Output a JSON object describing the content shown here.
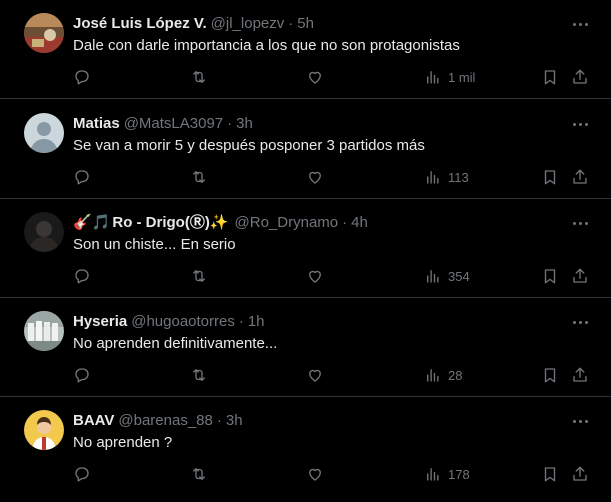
{
  "replies": [
    {
      "name": "José Luis López V.",
      "handle": "@jl_lopezv",
      "time": "5h",
      "text": "Dale con darle importancia a los que no son protagonistas",
      "views": "1 mil",
      "avatar": "landscape-photo-avatar"
    },
    {
      "name": "Matias",
      "handle": "@MatsLA3097",
      "time": "3h",
      "text": "Se van a morir 5 y después posponer 3 partidos más",
      "views": "113",
      "avatar": "default-avatar"
    },
    {
      "name_prefix": "🎸🎵",
      "name": "Ro - Drigo(Ⓡ)",
      "name_suffix": "✨",
      "handle": "@Ro_Drynamo",
      "time": "4h",
      "text": "Son un chiste... En serio",
      "views": "354",
      "avatar": "dark-silhouette-avatar"
    },
    {
      "name": "Hyseria",
      "handle": "@hugoaotorres",
      "time": "1h",
      "text": "No aprenden definitivamente...",
      "views": "28",
      "avatar": "group-photo-avatar"
    },
    {
      "name": "BAAV",
      "handle": "@barenas_88",
      "time": "3h",
      "text": "No aprenden ?",
      "views": "178",
      "avatar": "cartoon-person-avatar"
    }
  ],
  "separator": "·",
  "icons": {
    "reply": "reply-icon",
    "retweet": "retweet-icon",
    "like": "like-icon",
    "views": "views-icon",
    "bookmark": "bookmark-icon",
    "share": "share-icon",
    "more": "more-icon"
  },
  "colors": {
    "background": "#000000",
    "text": "#e7e9ea",
    "secondary": "#71767b",
    "border": "#2f3336"
  }
}
